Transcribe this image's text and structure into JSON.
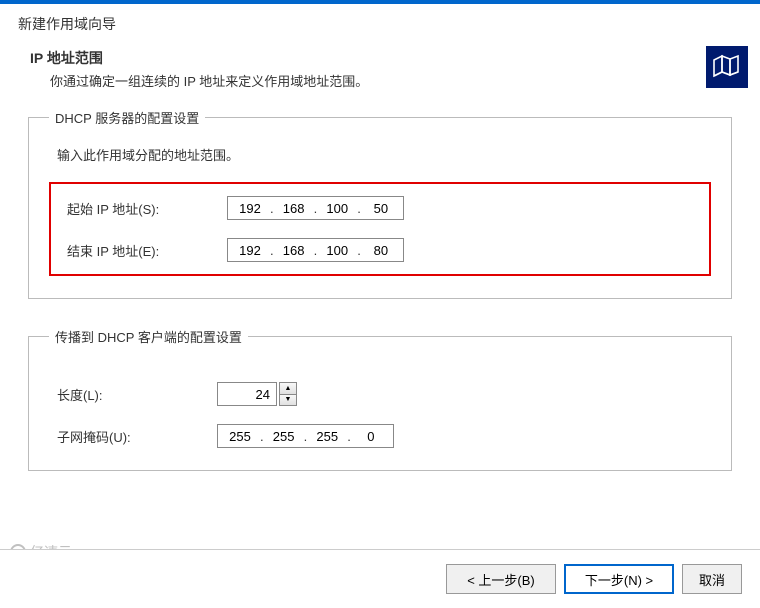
{
  "wizard": {
    "title": "新建作用域向导"
  },
  "header": {
    "heading": "IP 地址范围",
    "subheading": "你通过确定一组连续的 IP 地址来定义作用域地址范围。",
    "icon": "books-icon"
  },
  "dhcp_group": {
    "legend": "DHCP 服务器的配置设置",
    "prompt": "输入此作用域分配的地址范围。",
    "start_label": "起始 IP 地址(S):",
    "end_label": "结束 IP 地址(E):",
    "start_ip": [
      "192",
      "168",
      "100",
      "50"
    ],
    "end_ip": [
      "192",
      "168",
      "100",
      "80"
    ]
  },
  "client_group": {
    "legend": "传播到 DHCP 客户端的配置设置",
    "length_label": "长度(L):",
    "length_value": "24",
    "mask_label": "子网掩码(U):",
    "mask": [
      "255",
      "255",
      "255",
      "0"
    ]
  },
  "footer": {
    "back": "< 上一步(B)",
    "next": "下一步(N) >",
    "cancel": "取消"
  },
  "watermark": "亿速云"
}
